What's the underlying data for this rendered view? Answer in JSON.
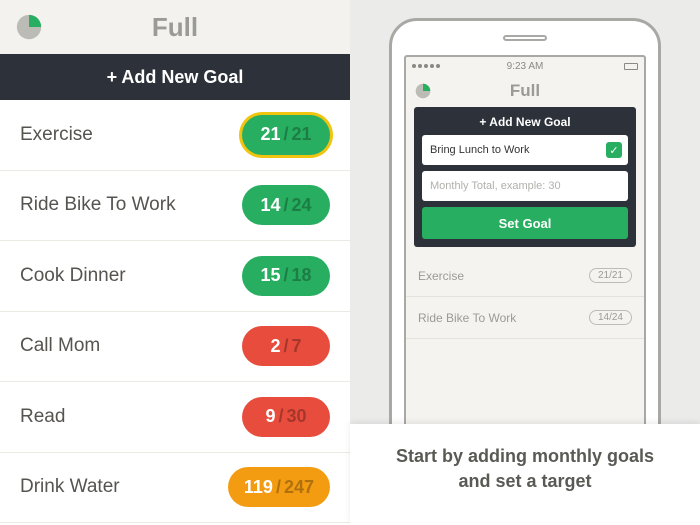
{
  "left": {
    "title": "Full",
    "add_label": "+ Add New Goal",
    "goals": [
      {
        "label": "Exercise",
        "current": "21",
        "total": "21",
        "color": "green",
        "done": true
      },
      {
        "label": "Ride Bike To Work",
        "current": "14",
        "total": "24",
        "color": "green",
        "done": false
      },
      {
        "label": "Cook Dinner",
        "current": "15",
        "total": "18",
        "color": "green",
        "done": false
      },
      {
        "label": "Call Mom",
        "current": "2",
        "total": "7",
        "color": "red",
        "done": false
      },
      {
        "label": "Read",
        "current": "9",
        "total": "30",
        "color": "red",
        "done": false
      },
      {
        "label": "Drink Water",
        "current": "119",
        "total": "247",
        "color": "orange",
        "done": false
      }
    ]
  },
  "right": {
    "status_time": "9:23 AM",
    "mini_title": "Full",
    "panel_title": "+ Add New Goal",
    "input_value": "Bring Lunch to Work",
    "input_placeholder": "Monthly Total, example: 30",
    "set_goal_label": "Set Goal",
    "mini_goals": [
      {
        "label": "Exercise",
        "progress": "21/21"
      },
      {
        "label": "Ride Bike To Work",
        "progress": "14/24"
      }
    ],
    "caption_line1": "Start by adding monthly goals",
    "caption_line2": "and set a target"
  }
}
